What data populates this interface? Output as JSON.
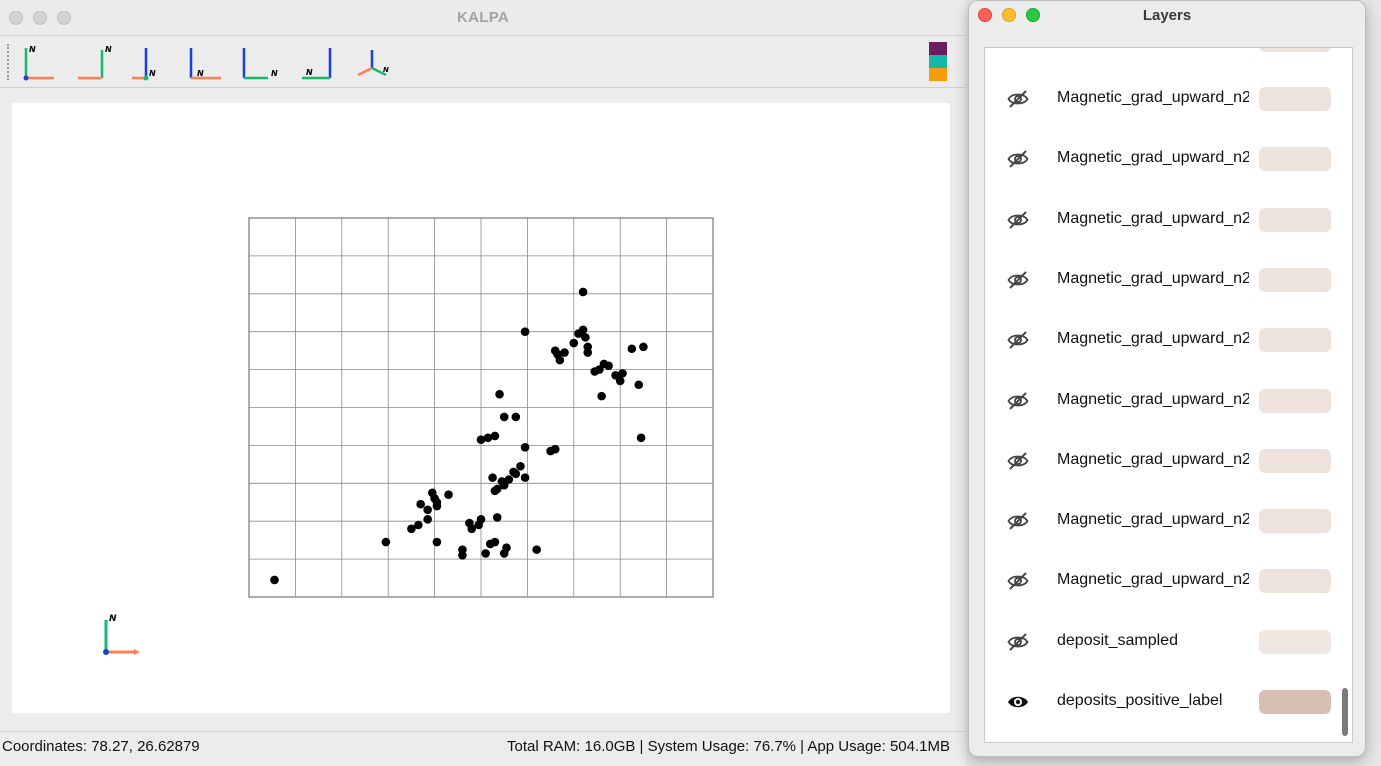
{
  "main_window": {
    "title": "KALPA",
    "toolbar": {
      "view_buttons": [
        "view-front",
        "view-right",
        "view-back",
        "view-left",
        "view-top",
        "view-bottom",
        "view-isometric"
      ],
      "color_swatches": [
        "#6a1f5c",
        "#14b8a6",
        "#f59e0b"
      ]
    },
    "status": {
      "coordinates": "Coordinates: 78.27, 26.62879",
      "usage": "Total RAM: 16.0GB | System Usage: 76.7% | App Usage: 504.1MB"
    },
    "axis_label": "N"
  },
  "chart_data": {
    "type": "scatter",
    "title": "",
    "xlabel": "",
    "ylabel": "",
    "xlim": [
      0,
      10
    ],
    "ylim": [
      0,
      10
    ],
    "grid": true,
    "grid_divisions": {
      "x": 10,
      "y": 10
    },
    "point_color": "#000000",
    "points": [
      [
        0.55,
        0.45
      ],
      [
        2.95,
        1.45
      ],
      [
        3.5,
        1.8
      ],
      [
        3.65,
        1.9
      ],
      [
        3.85,
        2.05
      ],
      [
        3.85,
        2.3
      ],
      [
        3.7,
        2.45
      ],
      [
        4.0,
        2.6
      ],
      [
        4.05,
        2.5
      ],
      [
        4.05,
        2.4
      ],
      [
        4.3,
        2.7
      ],
      [
        3.95,
        2.75
      ],
      [
        4.05,
        1.45
      ],
      [
        4.6,
        1.25
      ],
      [
        4.6,
        1.1
      ],
      [
        5.1,
        1.15
      ],
      [
        5.2,
        1.4
      ],
      [
        5.3,
        1.45
      ],
      [
        5.55,
        1.3
      ],
      [
        5.5,
        1.15
      ],
      [
        6.2,
        1.25
      ],
      [
        4.75,
        1.95
      ],
      [
        4.8,
        1.8
      ],
      [
        4.95,
        1.9
      ],
      [
        5.0,
        2.05
      ],
      [
        5.35,
        2.1
      ],
      [
        5.3,
        2.8
      ],
      [
        5.25,
        3.15
      ],
      [
        5.35,
        2.85
      ],
      [
        5.45,
        3.05
      ],
      [
        5.5,
        2.95
      ],
      [
        5.6,
        3.1
      ],
      [
        5.7,
        3.3
      ],
      [
        5.75,
        3.25
      ],
      [
        5.85,
        3.45
      ],
      [
        5.95,
        3.15
      ],
      [
        5.5,
        4.75
      ],
      [
        5.4,
        5.35
      ],
      [
        5.75,
        4.75
      ],
      [
        5.3,
        4.25
      ],
      [
        5.15,
        4.2
      ],
      [
        5.0,
        4.15
      ],
      [
        5.95,
        3.95
      ],
      [
        6.5,
        3.85
      ],
      [
        6.6,
        3.9
      ],
      [
        5.95,
        7.0
      ],
      [
        6.6,
        6.5
      ],
      [
        6.65,
        6.4
      ],
      [
        6.7,
        6.25
      ],
      [
        6.8,
        6.45
      ],
      [
        7.0,
        6.7
      ],
      [
        7.1,
        6.95
      ],
      [
        7.2,
        7.05
      ],
      [
        7.25,
        6.85
      ],
      [
        7.3,
        6.6
      ],
      [
        7.3,
        6.45
      ],
      [
        7.2,
        8.05
      ],
      [
        7.45,
        5.95
      ],
      [
        7.55,
        6.0
      ],
      [
        7.75,
        6.1
      ],
      [
        7.6,
        5.3
      ],
      [
        7.9,
        5.85
      ],
      [
        8.0,
        5.7
      ],
      [
        8.25,
        6.55
      ],
      [
        8.5,
        6.6
      ],
      [
        8.05,
        5.9
      ],
      [
        8.4,
        5.6
      ],
      [
        8.45,
        4.2
      ],
      [
        7.65,
        6.15
      ]
    ]
  },
  "layers_window": {
    "title": "Layers",
    "layers": [
      {
        "name": "Magnetic_grad_upward_n2",
        "visible": false,
        "color": "#eee2dd"
      },
      {
        "name": "Magnetic_grad_upward_n2",
        "visible": false,
        "color": "#eee2dd"
      },
      {
        "name": "Magnetic_grad_upward_n2",
        "visible": false,
        "color": "#eee2dd"
      },
      {
        "name": "Magnetic_grad_upward_n2",
        "visible": false,
        "color": "#eee2dd"
      },
      {
        "name": "Magnetic_grad_upward_n2",
        "visible": false,
        "color": "#eee2dd"
      },
      {
        "name": "Magnetic_grad_upward_n2",
        "visible": false,
        "color": "#eee2dd"
      },
      {
        "name": "Magnetic_grad_upward_n2",
        "visible": false,
        "color": "#eee2dd"
      },
      {
        "name": "Magnetic_grad_upward_n2",
        "visible": false,
        "color": "#eee2dd"
      },
      {
        "name": "Magnetic_grad_upward_n2",
        "visible": false,
        "color": "#eee2dd"
      },
      {
        "name": "deposit_sampled",
        "visible": false,
        "color": "#f0e6e2"
      },
      {
        "name": "deposits_positive_label",
        "visible": true,
        "color": "#d7bfb4"
      }
    ]
  }
}
